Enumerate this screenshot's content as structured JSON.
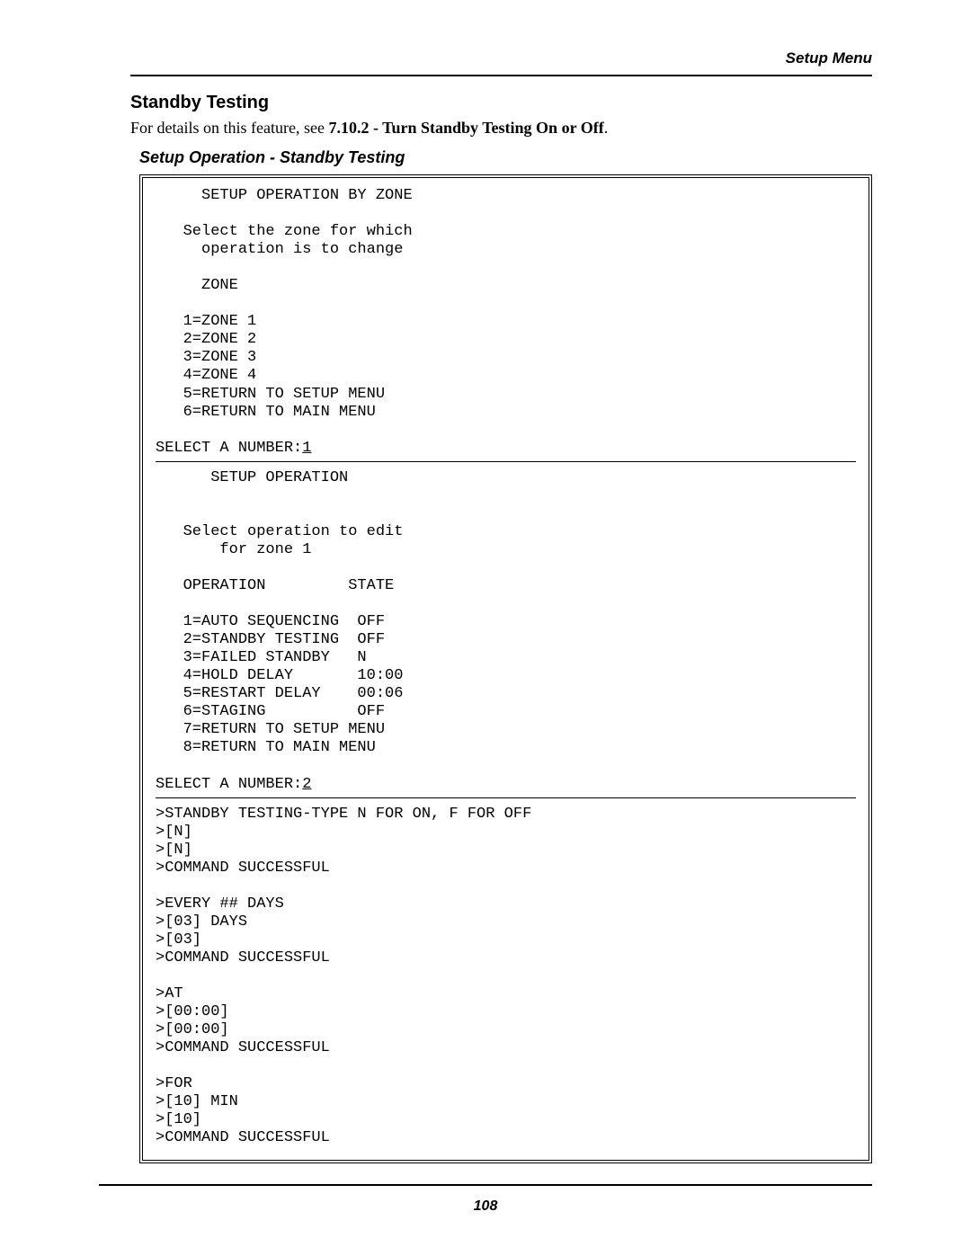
{
  "header": {
    "label": "Setup Menu"
  },
  "section": {
    "title": "Standby Testing",
    "intro_plain": "For details on this feature, see ",
    "intro_bold": "7.10.2 - Turn Standby Testing On or Off",
    "intro_end": ".",
    "subtitle": "Setup Operation - Standby Testing"
  },
  "terminal": {
    "block1": {
      "title": "     SETUP OPERATION BY ZONE",
      "prompt1": "   Select the zone for which",
      "prompt2": "     operation is to change",
      "zone_label": "     ZONE",
      "options": [
        "   1=ZONE 1",
        "   2=ZONE 2",
        "   3=ZONE 3",
        "   4=ZONE 4",
        "   5=RETURN TO SETUP MENU",
        "   6=RETURN TO MAIN MENU"
      ],
      "select_label": "SELECT A NUMBER:",
      "select_value": "1"
    },
    "block2": {
      "title": "      SETUP OPERATION",
      "prompt1": "   Select operation to edit",
      "prompt2": "       for zone 1",
      "header": "   OPERATION         STATE",
      "options": [
        "   1=AUTO SEQUENCING  OFF",
        "   2=STANDBY TESTING  OFF",
        "   3=FAILED STANDBY   N",
        "   4=HOLD DELAY       10:00",
        "   5=RESTART DELAY    00:06",
        "   6=STAGING          OFF",
        "   7=RETURN TO SETUP MENU",
        "   8=RETURN TO MAIN MENU"
      ],
      "select_label": "SELECT A NUMBER:",
      "select_value": "2"
    },
    "commands": [
      ">STANDBY TESTING-TYPE N FOR ON, F FOR OFF",
      ">[N]",
      ">[N]",
      ">COMMAND SUCCESSFUL",
      "",
      ">EVERY ## DAYS",
      ">[03] DAYS",
      ">[03]",
      ">COMMAND SUCCESSFUL",
      "",
      ">AT",
      ">[00:00]",
      ">[00:00]",
      ">COMMAND SUCCESSFUL",
      "",
      ">FOR",
      ">[10] MIN",
      ">[10]",
      ">COMMAND SUCCESSFUL"
    ]
  },
  "footer": {
    "page_number": "108"
  }
}
